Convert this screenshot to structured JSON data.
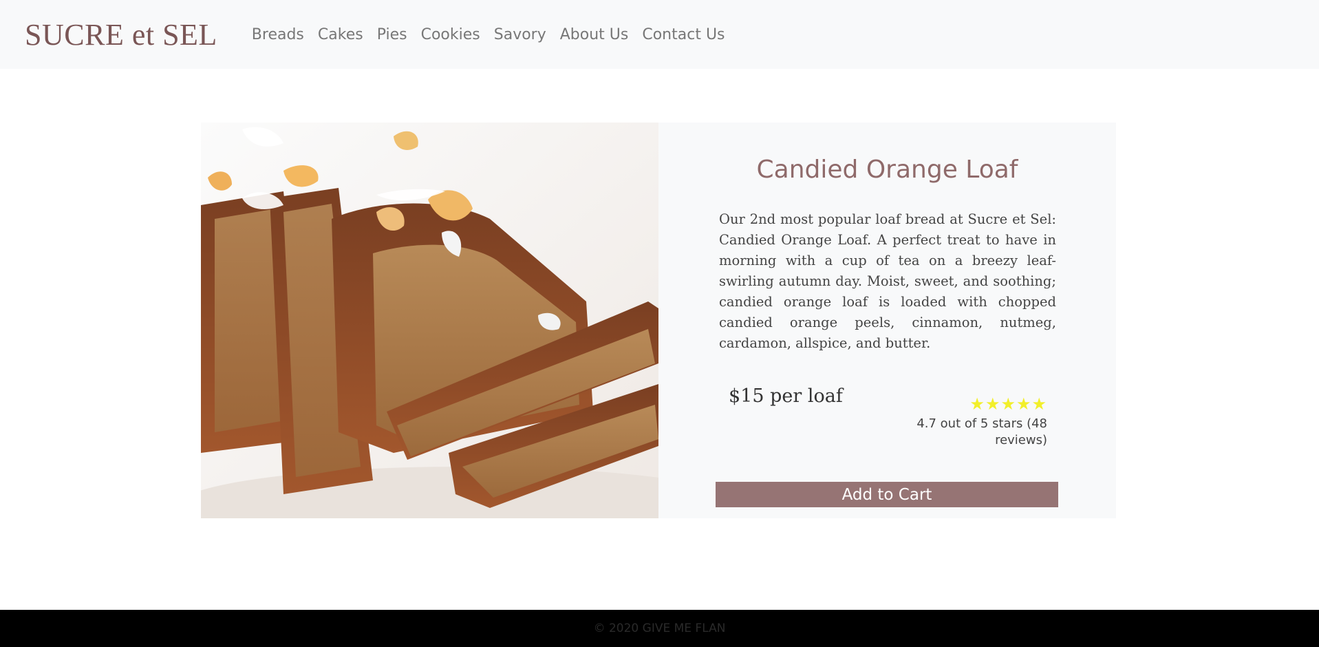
{
  "brand": {
    "name": "SUCRE et SEL",
    "color": "#7a5656"
  },
  "nav": {
    "links": [
      "Breads",
      "Cakes",
      "Pies",
      "Cookies",
      "Savory",
      "About Us",
      "Contact Us"
    ]
  },
  "product": {
    "image_alt": "Sliced candied orange loaf",
    "title": "Candied Orange Loaf",
    "description": "Our 2nd most popular loaf bread at Sucre et Sel: Candied Orange Loaf. A perfect treat to have in morning with a cup of tea on a breezy leaf-swirling autumn day. Moist, sweet, and soothing; candied orange loaf is loaded with chopped candied orange peels, cinnamon, nutmeg, cardamon, allspice, and butter.",
    "price": "$15 per loaf",
    "rating": {
      "stars_display": "★★★★★",
      "star_count": 5,
      "text": "4.7 out of 5 stars (48 reviews)"
    },
    "add_to_cart_label": "Add to Cart"
  },
  "footer": {
    "text": "© 2020 GIVE ME FLAN"
  },
  "colors": {
    "accent": "#967474",
    "title": "#8f6a6a",
    "star": "#f2ef2a",
    "navbar_bg": "#f8f9fa",
    "footer_bg": "#000000"
  }
}
